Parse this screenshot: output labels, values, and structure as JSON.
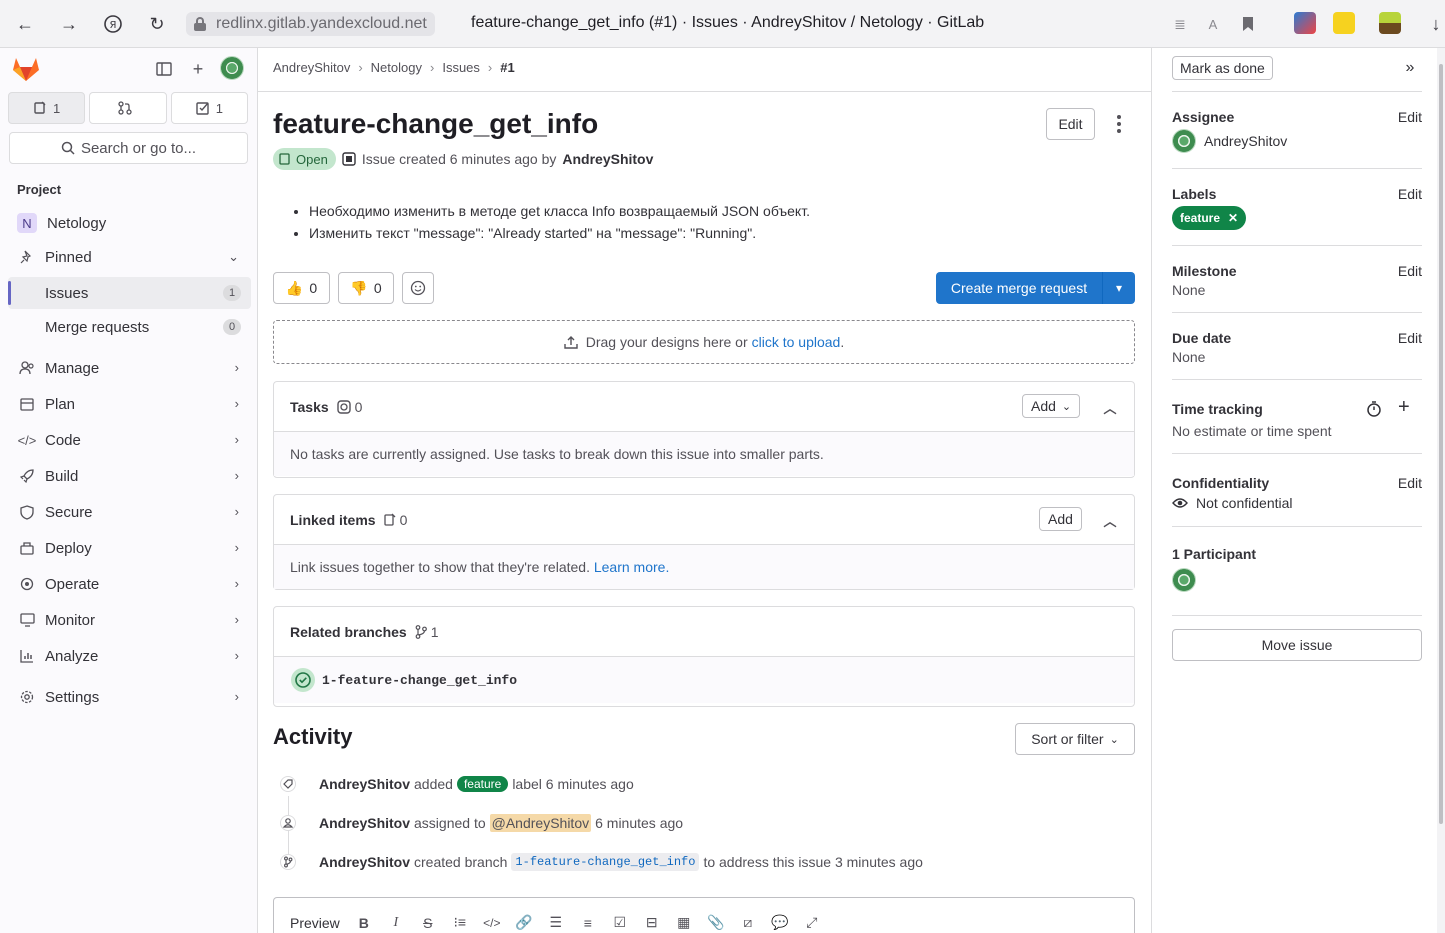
{
  "browser": {
    "url": "redlinx.gitlab.yandexcloud.net",
    "tab_title": "feature-change_get_info (#1) · Issues · AndreyShitov / Netology · GitLab"
  },
  "sidebar": {
    "counters": [
      {
        "icon": "issues-icon",
        "count": "1"
      },
      {
        "icon": "merge-request-icon",
        "count": ""
      },
      {
        "icon": "todo-icon",
        "count": "1"
      }
    ],
    "search_placeholder": "Search or go to...",
    "section_label": "Project",
    "project_initial": "N",
    "project_name": "Netology",
    "pinned_label": "Pinned",
    "pinned_items": [
      {
        "label": "Issues",
        "count": "1"
      },
      {
        "label": "Merge requests",
        "count": "0"
      }
    ],
    "nav": [
      {
        "label": "Manage",
        "icon": "users-icon"
      },
      {
        "label": "Plan",
        "icon": "calendar-icon"
      },
      {
        "label": "Code",
        "icon": "code-icon"
      },
      {
        "label": "Build",
        "icon": "rocket-icon"
      },
      {
        "label": "Secure",
        "icon": "shield-icon"
      },
      {
        "label": "Deploy",
        "icon": "deploy-icon"
      },
      {
        "label": "Operate",
        "icon": "operate-icon"
      },
      {
        "label": "Monitor",
        "icon": "monitor-icon"
      },
      {
        "label": "Analyze",
        "icon": "chart-icon"
      }
    ],
    "settings_label": "Settings"
  },
  "breadcrumb": [
    "AndreyShitov",
    "Netology",
    "Issues",
    "#1"
  ],
  "issue": {
    "title": "feature-change_get_info",
    "edit_label": "Edit",
    "status": "Open",
    "created_text": "Issue created 6 minutes ago by",
    "author": "AndreyShitov",
    "description": [
      "Необходимо изменить в методе get класса Info возвращаемый JSON объект.",
      "Изменить текст \"message\": \"Already started\" на \"message\": \"Running\"."
    ],
    "thumbs_up": "0",
    "thumbs_down": "0",
    "create_mr_label": "Create merge request",
    "dropzone_text": "Drag your designs here or",
    "dropzone_link": "click to upload",
    "dropzone_end": "."
  },
  "tasks": {
    "title": "Tasks",
    "count": "0",
    "add_label": "Add",
    "empty_text": "No tasks are currently assigned. Use tasks to break down this issue into smaller parts."
  },
  "linked": {
    "title": "Linked items",
    "count": "0",
    "add_label": "Add",
    "empty_text": "Link issues together to show that they're related.",
    "learn_more": "Learn more."
  },
  "branches": {
    "title": "Related branches",
    "count": "1",
    "branch": "1-feature-change_get_info"
  },
  "activity": {
    "title": "Activity",
    "sort_label": "Sort or filter",
    "items": [
      {
        "user": "AndreyShitov",
        "pre": "added",
        "label": "feature",
        "post": "label 6 minutes ago"
      },
      {
        "user": "AndreyShitov",
        "pre": "assigned to",
        "mention": "@AndreyShitov",
        "post": "6 minutes ago"
      },
      {
        "user": "AndreyShitov",
        "pre": "created branch",
        "code": "1-feature-change_get_info",
        "post": "to address this issue 3 minutes ago"
      }
    ],
    "editor_preview": "Preview"
  },
  "right": {
    "mark_done": "Mark as done",
    "assignee_title": "Assignee",
    "assignee": "AndreyShitov",
    "labels_title": "Labels",
    "label": "feature",
    "milestone_title": "Milestone",
    "milestone": "None",
    "due_title": "Due date",
    "due": "None",
    "time_title": "Time tracking",
    "time_value": "No estimate or time spent",
    "conf_title": "Confidentiality",
    "conf_value": "Not confidential",
    "participants_title": "1 Participant",
    "edit_label": "Edit",
    "move_label": "Move issue"
  },
  "colors": {
    "primary": "#1f75cb",
    "label_green": "#108548",
    "open_badge": "#c3e6cd"
  }
}
